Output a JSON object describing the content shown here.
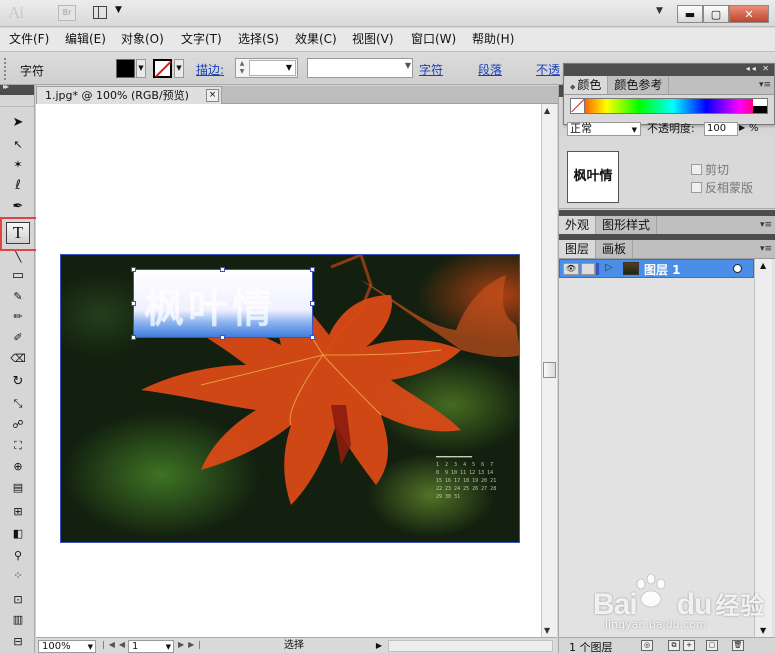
{
  "titlebar": {
    "app_logo": "Ai",
    "bridge_label": "Br",
    "window_min": "▬",
    "window_max": "▢",
    "window_close": "✕"
  },
  "menu": {
    "items": [
      "文件(F)",
      "编辑(E)",
      "对象(O)",
      "文字(T)",
      "选择(S)",
      "效果(C)",
      "视图(V)",
      "窗口(W)",
      "帮助(H)"
    ]
  },
  "control_bar": {
    "mode_label": "字符",
    "stroke_label": "描边:",
    "character_link": "字符",
    "paragraph_link": "段落",
    "opacity_link": "不透",
    "fill_color": "#000000"
  },
  "toolbar": {
    "active_tool": "type-tool",
    "type_tool_glyph": "T"
  },
  "document": {
    "tab_label": "1.jpg* @ 100% (RGB/预览)",
    "tab_close": "×",
    "calendar_days": "1  2  3  4  5  6  7\n8  9 10 11 12 13 14\n15 16 17 18 19 20 21\n22 23 24 25 26 27 28\n29 30 31",
    "frame_text": "枫叶情"
  },
  "statusbar": {
    "zoom": "100%",
    "page": "1",
    "status": "选择"
  },
  "color_panel": {
    "tabs": [
      "颜色",
      "颜色参考"
    ],
    "active_tab": "颜色"
  },
  "transparency": {
    "blend_mode": "正常",
    "opacity_label": "不透明度:",
    "opacity_value": "100",
    "opacity_unit": "%",
    "preview_text": "枫叶情",
    "clip_label": "剪切",
    "invert_mask_label": "反相蒙版"
  },
  "appearance": {
    "tabs": [
      "外观",
      "图形样式"
    ]
  },
  "layers": {
    "tabs": [
      "图层",
      "画板"
    ],
    "rows": [
      {
        "name": "图层 1"
      }
    ],
    "count_label": "1 个图层"
  },
  "watermark": {
    "brand": "Bai",
    "brand_cn": "经验",
    "url": "jingyan.baidu.com"
  }
}
